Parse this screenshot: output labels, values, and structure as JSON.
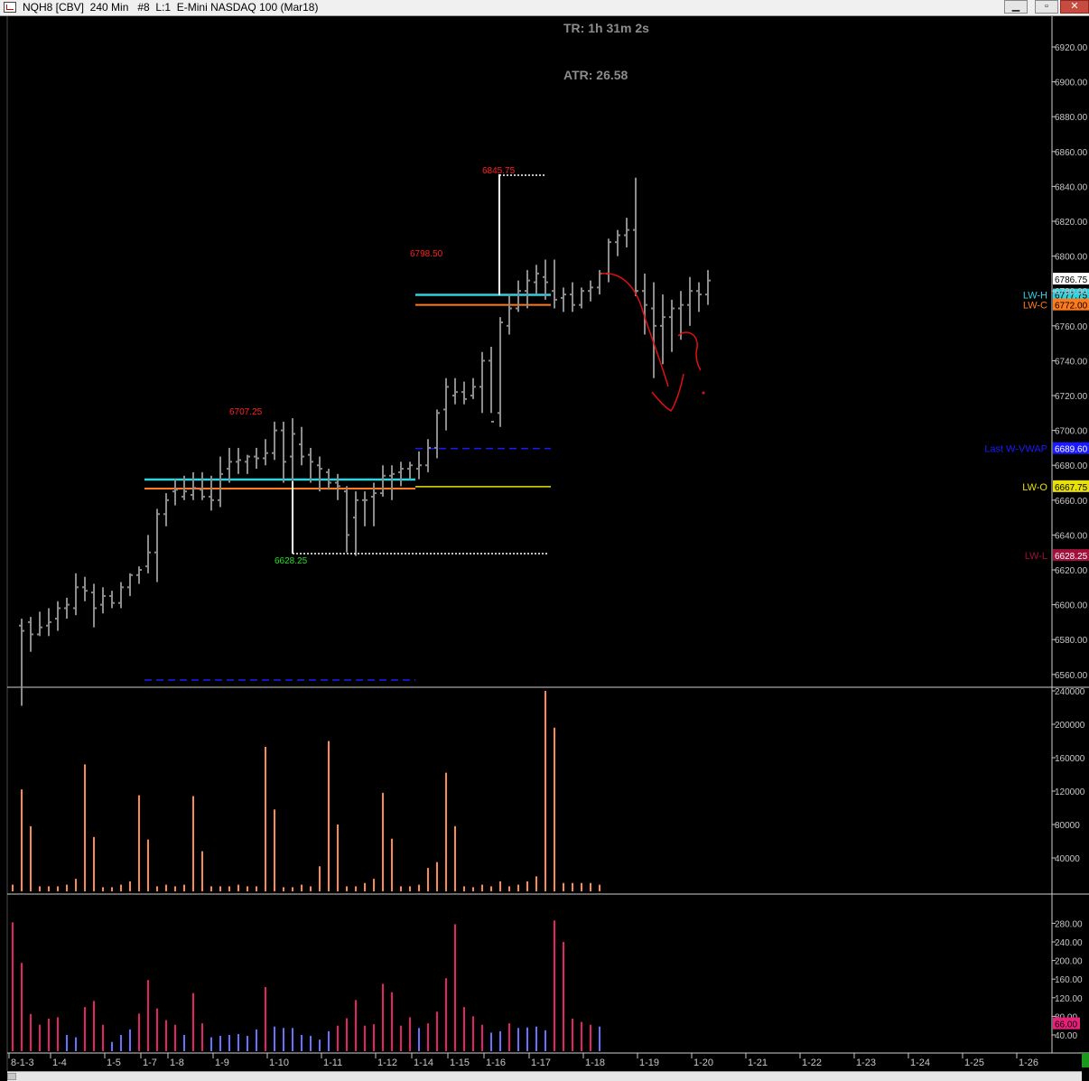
{
  "window": {
    "title": "NQH8 [CBV]  240 Min   #8  L:1  E-Mini NASDAQ 100 (Mar18)",
    "min": "▁",
    "max": "▫",
    "close": "✕"
  },
  "info": {
    "tr": "TR: 1h 31m 2s",
    "atr": "ATR: 26.58"
  },
  "chart_data": [
    {
      "type": "bar",
      "subtype": "ohlc",
      "panel": "price",
      "ylim": [
        6540,
        6930
      ],
      "yticks": [
        6560,
        6580,
        6600,
        6620,
        6640,
        6660,
        6680,
        6700,
        6720,
        6740,
        6760,
        6780,
        6800,
        6820,
        6840,
        6860,
        6880,
        6900,
        6920
      ],
      "bars": [
        [
          6588,
          6592,
          6542,
          6585
        ],
        [
          6590,
          6593,
          6573,
          6583
        ],
        [
          6583,
          6596,
          6582,
          6587
        ],
        [
          6588,
          6598,
          6582,
          6590
        ],
        [
          6592,
          6602,
          6585,
          6598
        ],
        [
          6598,
          6604,
          6592,
          6600
        ],
        [
          6598,
          6618,
          6594,
          6610
        ],
        [
          6610,
          6616,
          6602,
          6608
        ],
        [
          6607,
          6612,
          6587,
          6598
        ],
        [
          6600,
          6610,
          6595,
          6605
        ],
        [
          6605,
          6608,
          6598,
          6601
        ],
        [
          6601,
          6613,
          6598,
          6610
        ],
        [
          6610,
          6618,
          6605,
          6617
        ],
        [
          6617,
          6622,
          6612,
          6620
        ],
        [
          6622,
          6640,
          6618,
          6630
        ],
        [
          6630,
          6655,
          6613,
          6652
        ],
        [
          6652,
          6664,
          6645,
          6660
        ],
        [
          6665,
          6672,
          6657,
          6666
        ],
        [
          6662,
          6674,
          6660,
          6665
        ],
        [
          6663,
          6676,
          6660,
          6667
        ],
        [
          6666,
          6676,
          6660,
          6662
        ],
        [
          6662,
          6674,
          6654,
          6660
        ],
        [
          6660,
          6685,
          6656,
          6675
        ],
        [
          6678,
          6690,
          6670,
          6682
        ],
        [
          6682,
          6690,
          6675,
          6683
        ],
        [
          6682,
          6686,
          6675,
          6685
        ],
        [
          6685,
          6690,
          6678,
          6684
        ],
        [
          6684,
          6695,
          6680,
          6687
        ],
        [
          6687,
          6705,
          6683,
          6700
        ],
        [
          6700,
          6705,
          6670,
          6682
        ],
        [
          6685,
          6707,
          6670,
          6698
        ],
        [
          6692,
          6702,
          6680,
          6685
        ],
        [
          6686,
          6690,
          6670,
          6682
        ],
        [
          6680,
          6685,
          6665,
          6678
        ],
        [
          6676,
          6678,
          6666,
          6670
        ],
        [
          6670,
          6675,
          6660,
          6668
        ],
        [
          6665,
          6668,
          6630,
          6640
        ],
        [
          6650,
          6665,
          6628,
          6660
        ],
        [
          6660,
          6665,
          6645,
          6660
        ],
        [
          6662,
          6670,
          6645,
          6664
        ],
        [
          6664,
          6680,
          6662,
          6674
        ],
        [
          6674,
          6680,
          6660,
          6675
        ],
        [
          6676,
          6682,
          6668,
          6678
        ],
        [
          6678,
          6682,
          6672,
          6680
        ],
        [
          6678,
          6688,
          6672,
          6680
        ],
        [
          6680,
          6695,
          6676,
          6690
        ],
        [
          6690,
          6712,
          6684,
          6710
        ],
        [
          6712,
          6730,
          6700,
          6725
        ],
        [
          6720,
          6730,
          6715,
          6722
        ],
        [
          6722,
          6728,
          6715,
          6718
        ],
        [
          6720,
          6730,
          6718,
          6725
        ],
        [
          6725,
          6745,
          6710,
          6740
        ],
        [
          6740,
          6748,
          6710,
          6705
        ],
        [
          6710,
          6765,
          6702,
          6762
        ],
        [
          6760,
          6778,
          6755,
          6770
        ],
        [
          6770,
          6786,
          6768,
          6780
        ],
        [
          6780,
          6792,
          6770,
          6786
        ],
        [
          6785,
          6795,
          6778,
          6790
        ],
        [
          6788,
          6798,
          6775,
          6785
        ],
        [
          6780,
          6798,
          6770,
          6775
        ],
        [
          6776,
          6782,
          6768,
          6778
        ],
        [
          6778,
          6785,
          6768,
          6772
        ],
        [
          6772,
          6782,
          6770,
          6780
        ],
        [
          6780,
          6786,
          6774,
          6782
        ],
        [
          6782,
          6792,
          6778,
          6790
        ],
        [
          6790,
          6810,
          6785,
          6808
        ],
        [
          6808,
          6815,
          6800,
          6812
        ],
        [
          6812,
          6822,
          6805,
          6815
        ],
        [
          6815,
          6845,
          6777,
          6780
        ],
        [
          6780,
          6790,
          6755,
          6772
        ],
        [
          6770,
          6785,
          6730,
          6760
        ],
        [
          6760,
          6778,
          6738,
          6765
        ],
        [
          6765,
          6775,
          6745,
          6770
        ],
        [
          6770,
          6780,
          6752,
          6772
        ],
        [
          6772,
          6788,
          6760,
          6780
        ],
        [
          6780,
          6785,
          6768,
          6778
        ],
        [
          6778,
          6792,
          6772,
          6786
        ]
      ],
      "levels": [
        {
          "label": "LW-H",
          "value": 6777.75,
          "color": "#2fd3e0"
        },
        {
          "label": "LW-C",
          "value": 6772.0,
          "color": "#ff7a1a"
        },
        {
          "label": "Last W-VWAP",
          "value": 6689.6,
          "color": "#1a1aff"
        },
        {
          "label": "LW-O",
          "value": 6667.75,
          "color": "#e8e00a"
        },
        {
          "label": "LW-L",
          "value": 6628.25,
          "color": "#a0103a"
        }
      ],
      "current_price": "6786.75",
      "annotations": [
        "6845.75",
        "6798.50",
        "6707.25",
        "6628.25"
      ]
    },
    {
      "type": "bar",
      "panel": "volume",
      "ylim": [
        0,
        240000
      ],
      "yticks": [
        40000,
        80000,
        120000,
        160000,
        200000,
        240000
      ],
      "values": [
        8000,
        122000,
        78000,
        6000,
        6000,
        6000,
        8000,
        15000,
        152000,
        65000,
        5000,
        5000,
        8000,
        12000,
        115000,
        62000,
        6000,
        8000,
        6000,
        8000,
        114000,
        48000,
        6000,
        6000,
        6000,
        8000,
        6000,
        6000,
        173000,
        98000,
        5000,
        5000,
        8000,
        6000,
        30000,
        180000,
        80000,
        6000,
        6000,
        10000,
        15000,
        118000,
        63000,
        6000,
        6000,
        8000,
        28000,
        35000,
        142000,
        78000,
        6000,
        5000,
        8000,
        6000,
        12000,
        6000,
        8000,
        12000,
        18000,
        240000,
        196000,
        10000,
        10000,
        10000,
        10000,
        8000
      ]
    },
    {
      "type": "bar",
      "panel": "indicator",
      "ylim": [
        20,
        290
      ],
      "yticks": [
        40,
        60,
        80,
        100,
        120,
        140,
        160,
        180,
        200,
        220,
        240,
        260,
        280
      ],
      "current_value": "66.00",
      "values": [
        282,
        195,
        85,
        62,
        75,
        78,
        40,
        35,
        100,
        113,
        62,
        25,
        40,
        52,
        86,
        158,
        97,
        72,
        62,
        40,
        130,
        65,
        35,
        38,
        40,
        42,
        38,
        52,
        143,
        58,
        55,
        55,
        40,
        38,
        30,
        48,
        60,
        76,
        115,
        60,
        63,
        150,
        132,
        60,
        78,
        55,
        65,
        90,
        162,
        278,
        100,
        80,
        62,
        45,
        48,
        65,
        55,
        56,
        58,
        50,
        286,
        240,
        75,
        68,
        62,
        58
      ]
    }
  ],
  "axis": {
    "x_labels": [
      "8-1-3",
      "1-4",
      "1-5",
      "1-7",
      "1-8",
      "1-9",
      "1-10",
      "1-11",
      "1-12",
      "1-14",
      "1-15",
      "1-16",
      "1-17",
      "1-18",
      "1-19",
      "1-20",
      "1-21",
      "1-22",
      "1-23",
      "1-24",
      "1-25",
      "1-26"
    ],
    "vol_tick_labels": [
      "240000",
      "200000",
      "160000",
      "120000",
      "80000",
      "40000"
    ],
    "ind_tick_labels": [
      "280.00",
      "240.00",
      "200.00",
      "160.00",
      "120.00",
      "80.00",
      "40.00"
    ]
  },
  "colors": {
    "price_bar": "#8c8c8c",
    "volume": "#ff8a50",
    "indicator": "#e8206a",
    "indicator_low": "#6a70ff",
    "axis": "#c8c8c8",
    "drawing": "#e01010",
    "high_label": "#ff2020",
    "low_label": "#20e020"
  }
}
